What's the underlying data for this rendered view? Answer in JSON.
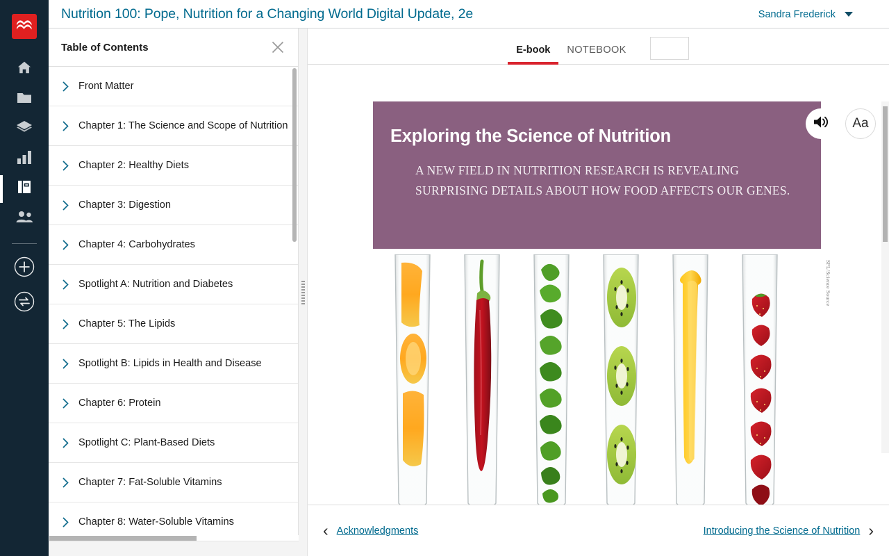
{
  "app": {
    "logo_icon": "macmillan-logo-icon",
    "accent_red": "#d9232e",
    "rail_bg": "#132634",
    "link_color": "#006a8e",
    "hero_bg": "#8a6080"
  },
  "rail": {
    "items": [
      {
        "icon": "home-icon",
        "name": "home"
      },
      {
        "icon": "folder-icon",
        "name": "resources"
      },
      {
        "icon": "layers-icon",
        "name": "assignments"
      },
      {
        "icon": "bar-chart-icon",
        "name": "gradebook"
      },
      {
        "icon": "book-icon",
        "name": "ebook",
        "active": true
      },
      {
        "icon": "people-icon",
        "name": "roster"
      }
    ],
    "actions": [
      {
        "icon": "plus-circle-icon",
        "name": "add"
      },
      {
        "icon": "swap-circle-icon",
        "name": "switch-course"
      }
    ]
  },
  "header": {
    "title": "Nutrition 100: Pope, Nutrition for a Changing World Digital Update, 2e",
    "user_name": "Sandra Frederick",
    "caret_icon": "chevron-down-icon"
  },
  "toc": {
    "title": "Table of Contents",
    "close_icon": "close-icon",
    "chevron_icon": "chevron-right-icon",
    "items": [
      {
        "label": "Front Matter"
      },
      {
        "label": "Chapter 1: The Science and Scope of Nutrition"
      },
      {
        "label": "Chapter 2: Healthy Diets"
      },
      {
        "label": "Chapter 3: Digestion"
      },
      {
        "label": "Chapter 4: Carbohydrates"
      },
      {
        "label": "Spotlight A: Nutrition and Diabetes"
      },
      {
        "label": "Chapter 5: The Lipids"
      },
      {
        "label": "Spotlight B: Lipids in Health and Disease"
      },
      {
        "label": "Chapter 6: Protein"
      },
      {
        "label": "Spotlight C: Plant-Based Diets"
      },
      {
        "label": "Chapter 7: Fat-Soluble Vitamins"
      },
      {
        "label": "Chapter 8: Water-Soluble Vitamins"
      }
    ]
  },
  "reader": {
    "tabs": [
      {
        "label": "E-book",
        "active": true
      },
      {
        "label": "NOTEBOOK",
        "active": false
      }
    ],
    "hero": {
      "heading": "Exploring the Science of Nutrition",
      "subheading": "A NEW FIELD IN NUTRITION RESEARCH IS REVEALING SURPRISING DETAILS ABOUT HOW FOOD AFFECTS OUR GENES.",
      "speaker_icon": "speaker-icon"
    },
    "font_button_label": "Aa",
    "figure": {
      "credit": "SPL/Science Source",
      "tubes": [
        "orange slices",
        "red chili pepper",
        "green parsley leaves",
        "kiwi slices",
        "yellow pepper strips",
        "strawberries"
      ]
    },
    "page_nav": {
      "prev_label": "Acknowledgments",
      "next_label": "Introducing the Science of Nutrition",
      "prev_icon": "chevron-left-icon",
      "next_icon": "chevron-right-icon"
    }
  }
}
